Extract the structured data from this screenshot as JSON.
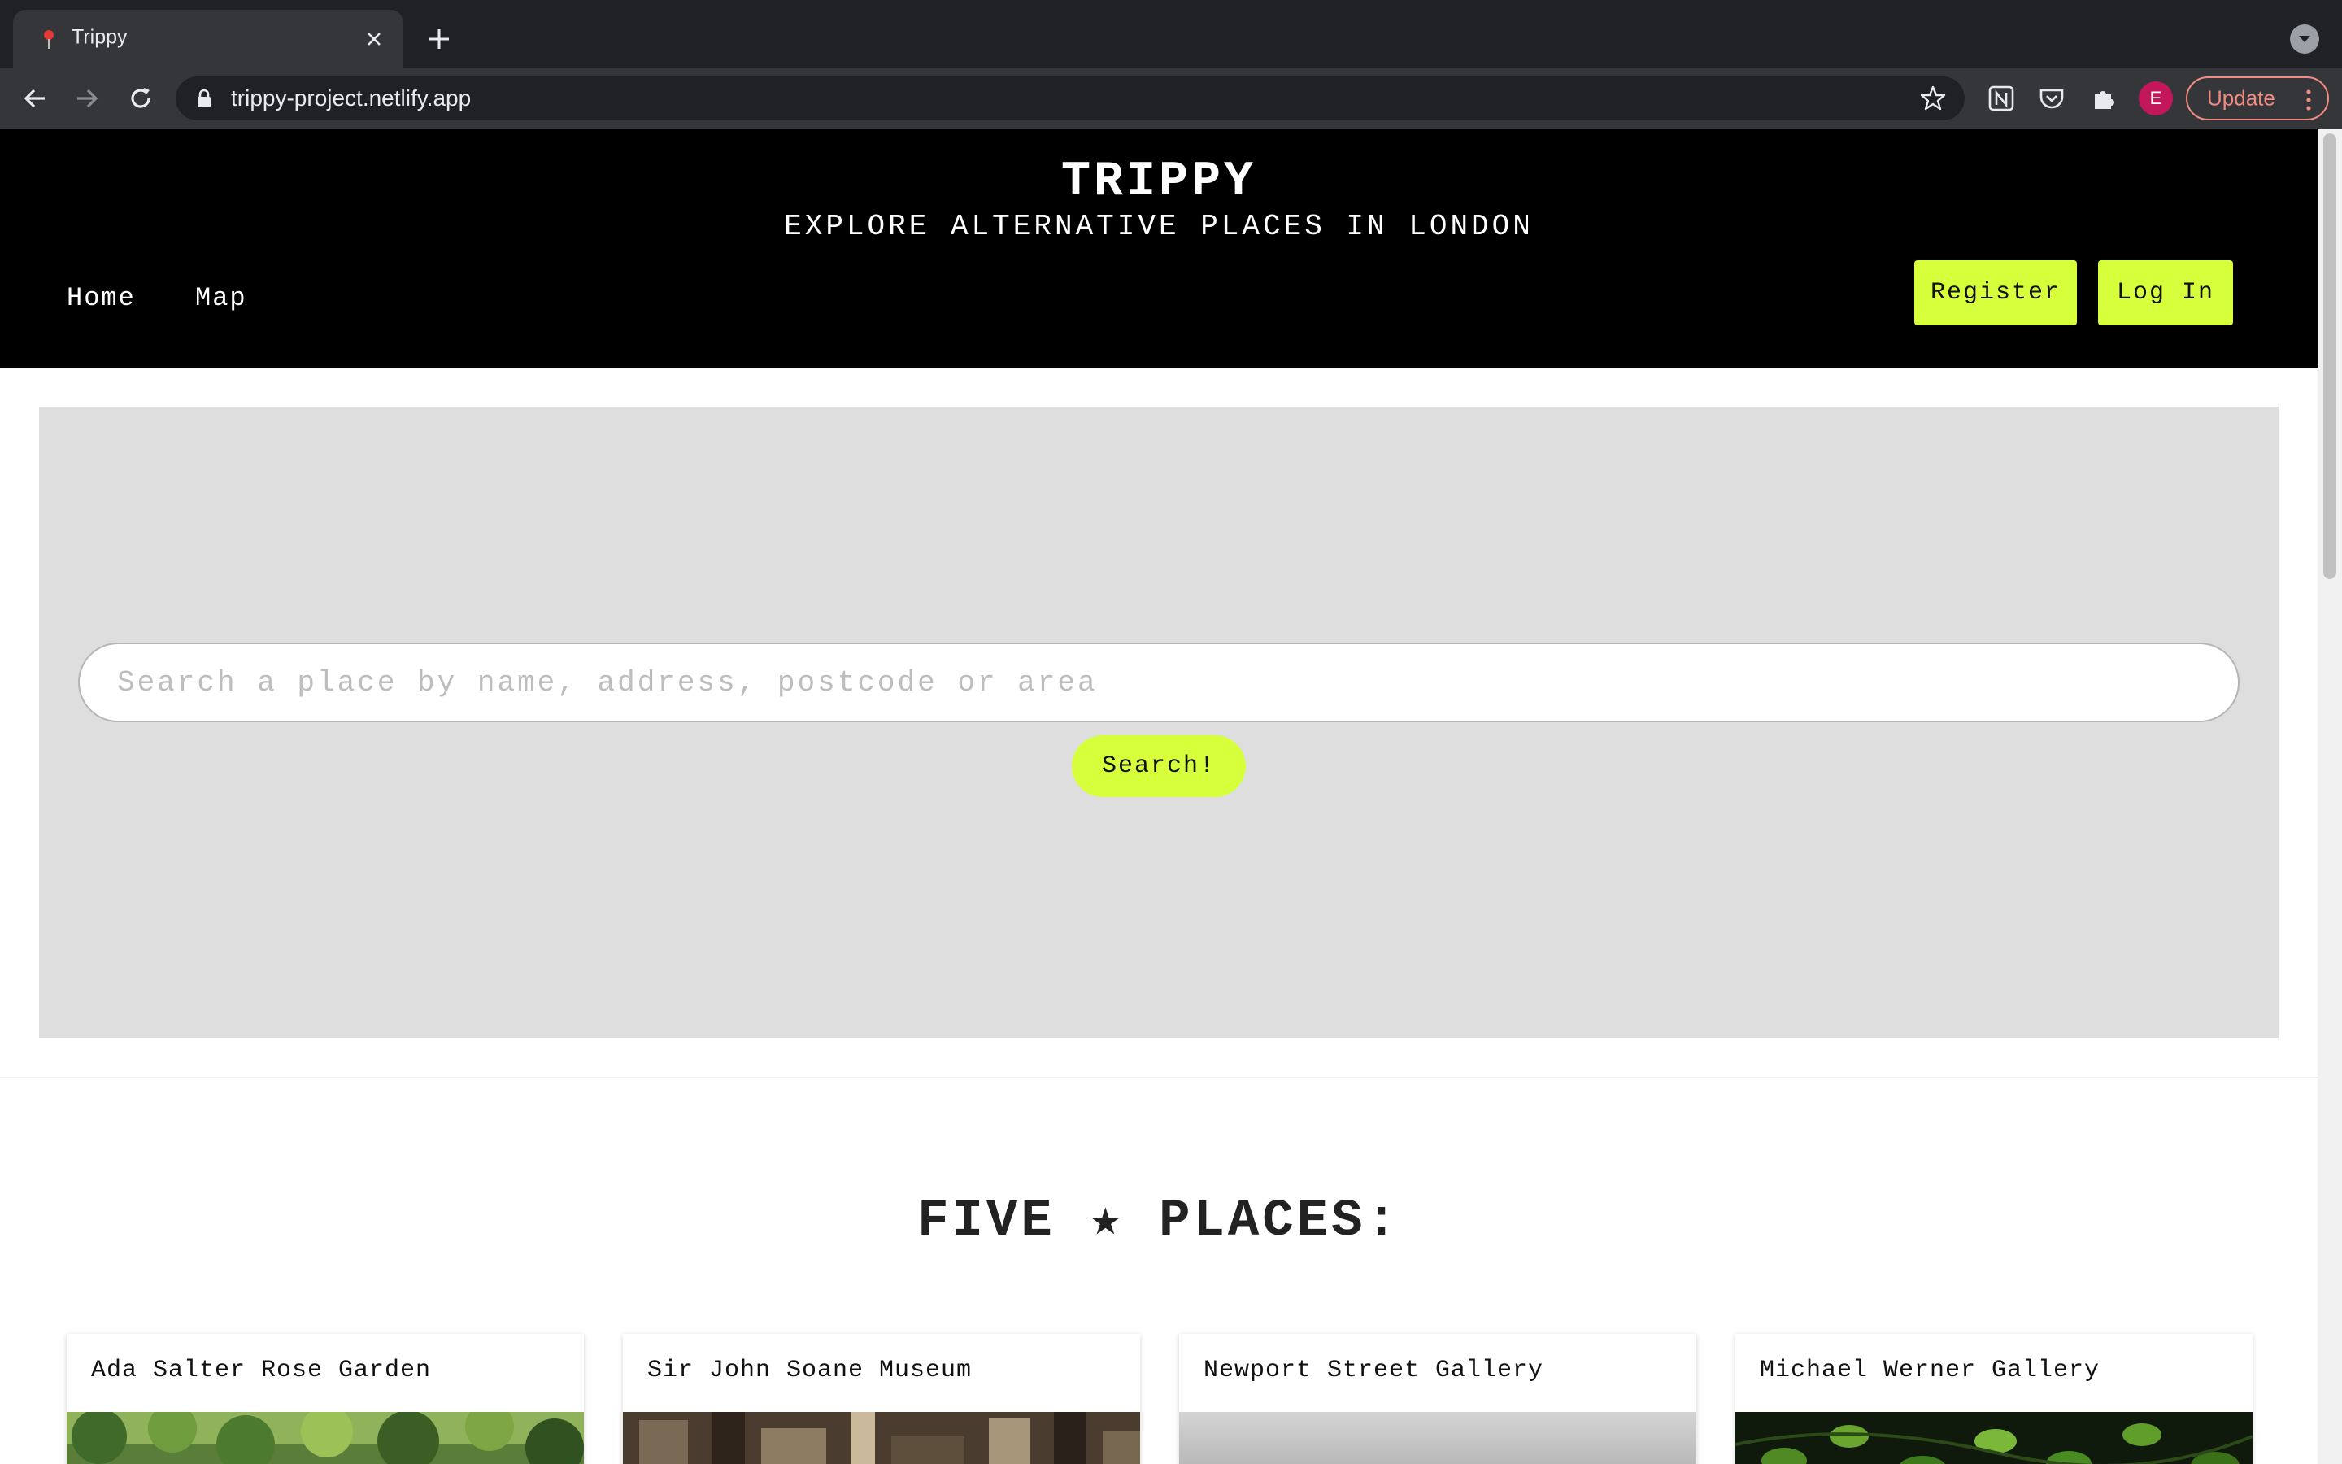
{
  "browser": {
    "tab_title": "Trippy",
    "url": "trippy-project.netlify.app",
    "avatar_letter": "E",
    "update_label": "Update"
  },
  "site": {
    "title": "TRIPPY",
    "subtitle": "EXPLORE ALTERNATIVE PLACES IN LONDON",
    "nav": [
      {
        "label": "Home"
      },
      {
        "label": "Map"
      }
    ],
    "register_label": "Register",
    "login_label": "Log In",
    "accent_color": "#d7ff3b"
  },
  "search": {
    "value": "",
    "placeholder": "Search a place by name, address, postcode or area",
    "button_label": "Search!"
  },
  "featured": {
    "title": "FIVE ★ PLACES:",
    "cards": [
      {
        "title": "Ada Salter Rose Garden"
      },
      {
        "title": "Sir John Soane Museum"
      },
      {
        "title": "Newport Street Gallery"
      },
      {
        "title": "Michael Werner Gallery"
      }
    ]
  }
}
